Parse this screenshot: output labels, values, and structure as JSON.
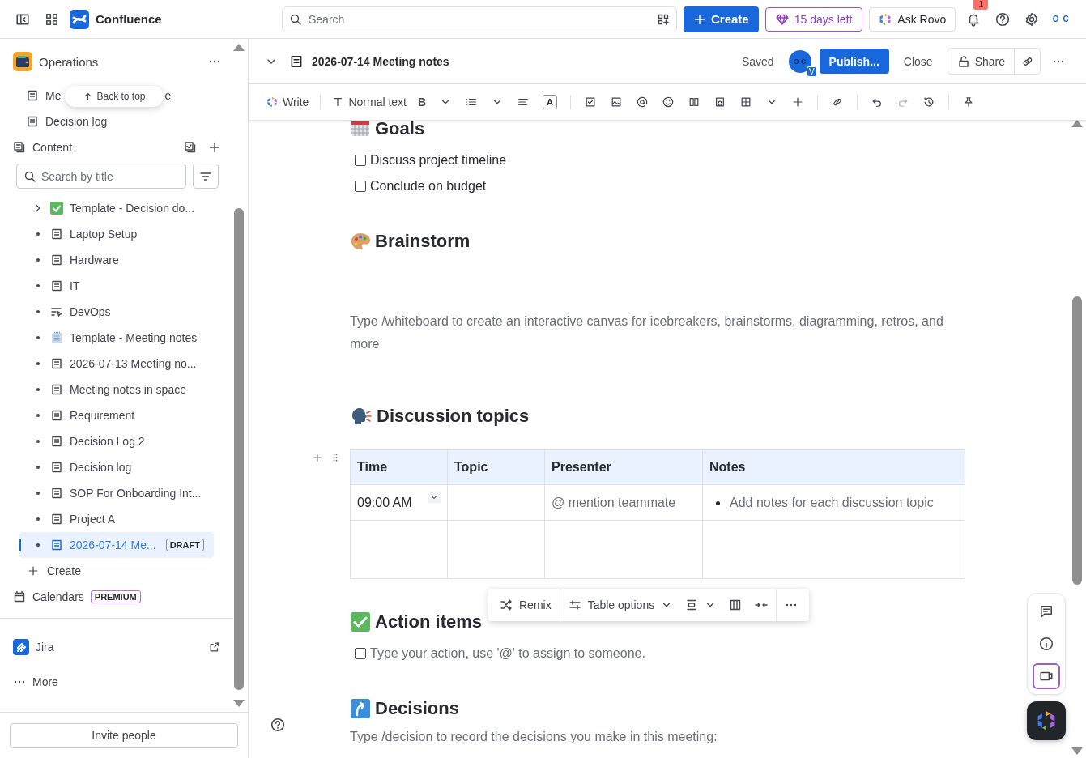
{
  "topbar": {
    "app_name": "Confluence",
    "search": {
      "placeholder": "Search"
    },
    "create_label": "Create",
    "trial_label": "15 days left",
    "rovo_label": "Ask Rovo",
    "notification_count": "1",
    "avatar_text": "O C"
  },
  "sidebar": {
    "space_name": "Operations",
    "pinned_partial": [
      "Me",
      "e"
    ],
    "pinned": [
      {
        "label": "Decision log"
      }
    ],
    "back_to_top": "Back to top",
    "content_label": "Content",
    "search": {
      "placeholder": "Search by title"
    },
    "tree": [
      {
        "label": "Template - Decision do...",
        "kind": "check",
        "expandable": true,
        "selected": false
      },
      {
        "label": "Laptop Setup",
        "kind": "page",
        "expandable": false,
        "selected": false
      },
      {
        "label": "Hardware",
        "kind": "page",
        "expandable": false,
        "selected": false
      },
      {
        "label": "IT",
        "kind": "page",
        "expandable": false,
        "selected": false
      },
      {
        "label": "DevOps",
        "kind": "devops",
        "expandable": false,
        "selected": false
      },
      {
        "label": "Template - Meeting notes",
        "kind": "notepad",
        "expandable": false,
        "selected": false
      },
      {
        "label": "2026-07-13 Meeting no...",
        "kind": "page",
        "expandable": false,
        "selected": false
      },
      {
        "label": "Meeting notes in space",
        "kind": "page",
        "expandable": false,
        "selected": false
      },
      {
        "label": "Requirement",
        "kind": "page",
        "expandable": false,
        "selected": false
      },
      {
        "label": "Decision Log 2",
        "kind": "page",
        "expandable": false,
        "selected": false
      },
      {
        "label": "Decision log",
        "kind": "page",
        "expandable": false,
        "selected": false
      },
      {
        "label": "SOP For Onboarding Int...",
        "kind": "page",
        "expandable": false,
        "selected": false
      },
      {
        "label": "Project A",
        "kind": "page",
        "expandable": false,
        "selected": false
      },
      {
        "label": "2026-07-14 Me...",
        "kind": "page",
        "expandable": false,
        "selected": true,
        "badge": "DRAFT"
      }
    ],
    "create_label": "Create",
    "calendars": {
      "label": "Calendars",
      "badge": "PREMIUM"
    },
    "apps": [
      {
        "label": "Jira"
      }
    ],
    "more_label": "More",
    "invite_label": "Invite people"
  },
  "page_header": {
    "title": "2026-07-14 Meeting notes",
    "status": "Saved",
    "avatar_text": "O C",
    "avatar_badge": "V",
    "publish_label": "Publish...",
    "close_label": "Close",
    "share_label": "Share"
  },
  "editor_toolbar": {
    "write_label": "Write",
    "text_style": "Normal text",
    "bold_label": "B",
    "text_color_label": "A"
  },
  "document": [
    {
      "kind": "heading",
      "text": "Goals"
    },
    {
      "kind": "task",
      "checked": false,
      "placeholder": false,
      "text": "Discuss project timeline"
    },
    {
      "kind": "task",
      "checked": false,
      "placeholder": false,
      "text": "Conclude on budget"
    },
    {
      "kind": "heading",
      "text": "Brainstorm"
    },
    {
      "kind": "placeholder",
      "text": "Type /whiteboard to create an interactive canvas for icebreakers, brainstorms, diagramming, retros, and more"
    },
    {
      "kind": "heading",
      "text": "Discussion topics"
    },
    {
      "kind": "table",
      "columns": [
        "Time",
        "Topic",
        "Presenter",
        "Notes"
      ],
      "rows": [
        {
          "cells": [
            {
              "kind": "time",
              "text": "09:00 AM"
            },
            {
              "kind": "empty"
            },
            {
              "kind": "placeholder",
              "text": "@ mention teammate"
            },
            {
              "kind": "bullet",
              "text": "Add notes for each discussion topic"
            }
          ]
        },
        {
          "cells": [
            {
              "kind": "empty"
            },
            {
              "kind": "empty"
            },
            {
              "kind": "empty"
            },
            {
              "kind": "empty"
            }
          ]
        }
      ],
      "toolbar": {
        "remix_label": "Remix",
        "options_label": "Table options"
      }
    },
    {
      "kind": "heading",
      "text": "Action items"
    },
    {
      "kind": "task",
      "checked": false,
      "placeholder": true,
      "text": "Type your action, use '@' to assign to someone."
    },
    {
      "kind": "heading",
      "text": "Decisions"
    },
    {
      "kind": "placeholder",
      "text": "Type /decision to record the decisions you make in this meeting:"
    }
  ]
}
